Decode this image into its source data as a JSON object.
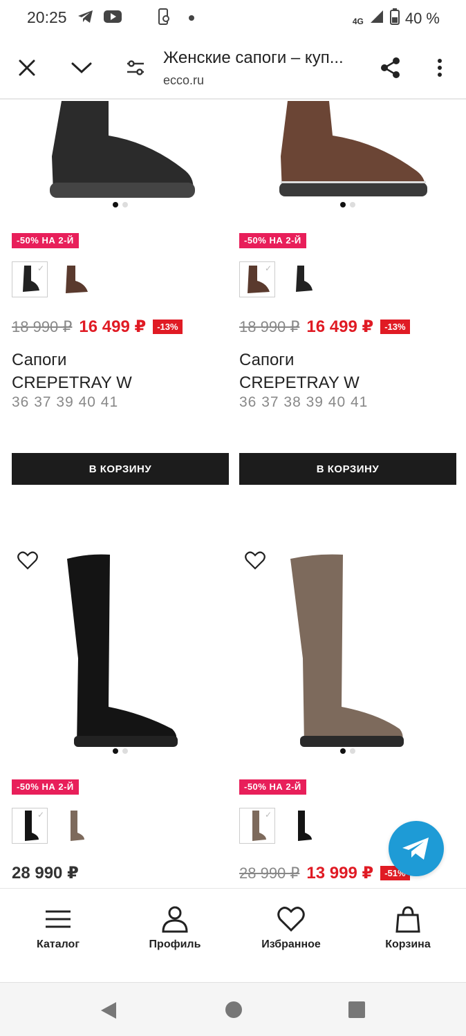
{
  "status_bar": {
    "time": "20:25",
    "network": "4G",
    "battery": "40 %"
  },
  "browser": {
    "title": "Женские сапоги – куп...",
    "domain": "ecco.ru",
    "icons": [
      "close-icon",
      "chevron-down-icon",
      "settings-sliders-icon",
      "share-icon",
      "more-vert-icon"
    ]
  },
  "products": [
    {
      "promo": "-50% НА 2-Й",
      "old_price": "18 990 ₽",
      "new_price": "16 499 ₽",
      "discount": "-13%",
      "name_line1": "Сапоги",
      "name_line2": "CREPETRAY W",
      "sizes": "36 37 39 40 41",
      "cart": "В КОРЗИНУ",
      "color": "#2a2a2a"
    },
    {
      "promo": "-50% НА 2-Й",
      "old_price": "18 990 ₽",
      "new_price": "16 499 ₽",
      "discount": "-13%",
      "name_line1": "Сапоги",
      "name_line2": "CREPETRAY W",
      "sizes": "36 37 38 39 40 41",
      "cart": "В КОРЗИНУ",
      "color": "#5a3a2e"
    },
    {
      "promo": "-50% НА 2-Й",
      "price": "28 990 ₽",
      "color": "#1a1a1a"
    },
    {
      "promo": "-50% НА 2-Й",
      "old_price": "28 990 ₽",
      "new_price": "13 999 ₽",
      "discount": "-51%",
      "color": "#7d6a5c"
    }
  ],
  "bottom_nav": {
    "catalog": "Каталог",
    "profile": "Профиль",
    "favorites": "Избранное",
    "cart": "Корзина"
  }
}
